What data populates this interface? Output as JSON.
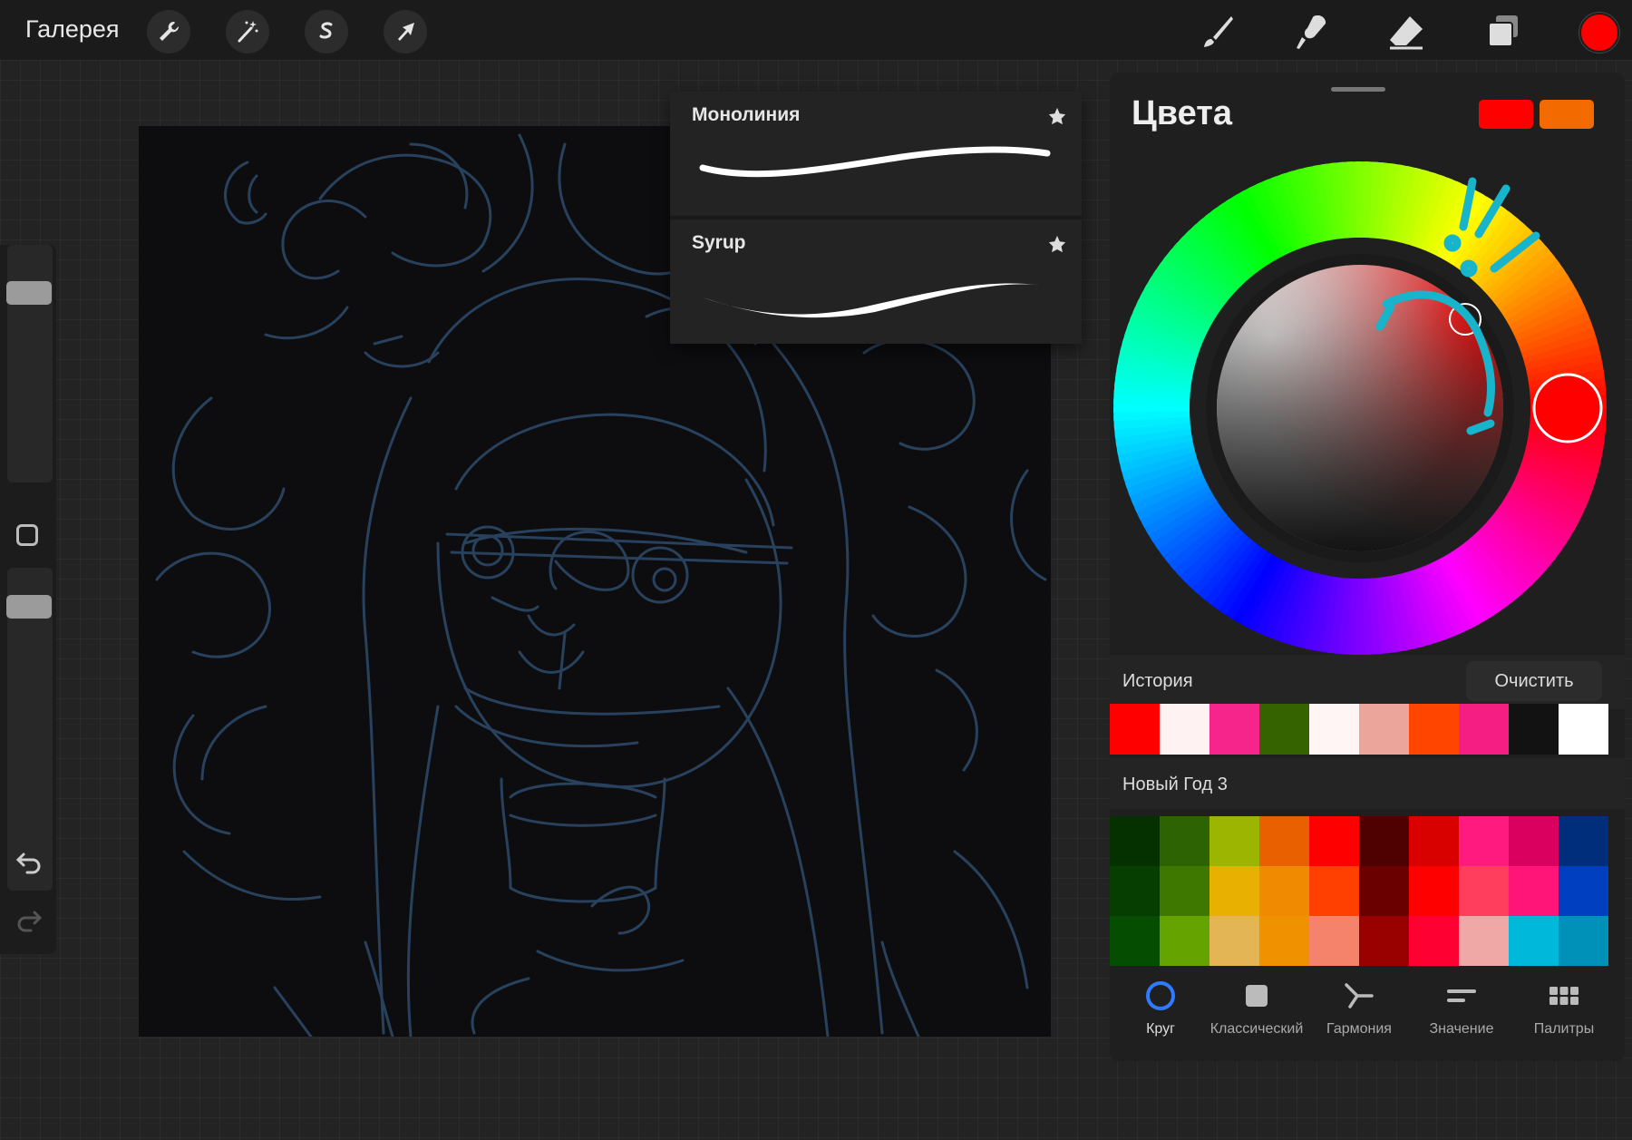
{
  "topbar": {
    "gallery_label": "Галерея",
    "current_color": "#ff0000"
  },
  "brushes": [
    {
      "name": "Монолиния",
      "favorite": true
    },
    {
      "name": "Syrup",
      "favorite": true
    }
  ],
  "colors_panel": {
    "title": "Цвета",
    "primary": "#ff0000",
    "secondary": "#f26a00",
    "history_label": "История",
    "clear_label": "Очистить",
    "history": [
      "#ff0000",
      "#fff2f2",
      "#f5258c",
      "#356300",
      "#fff5f5",
      "#eba59b",
      "#ff4500",
      "#f51e82",
      "#121212",
      "#ffffff"
    ],
    "palette_name": "Новый Год 3",
    "palette": [
      [
        "#053000",
        "#2e6303",
        "#9bb500",
        "#e86000",
        "#ff0000",
        "#4f0000",
        "#d90000",
        "#ff1a80",
        "#d90060",
        "#002e7a"
      ],
      [
        "#063d01",
        "#3f7800",
        "#e8b000",
        "#f08a00",
        "#ff4000",
        "#6b0000",
        "#ff0000",
        "#ff3d5c",
        "#ff1478",
        "#003fbf"
      ],
      [
        "#054d00",
        "#65a300",
        "#e3b555",
        "#f09200",
        "#f5826a",
        "#990000",
        "#ff0033",
        "#f0a8a6",
        "#00b8d9",
        "#0091b8"
      ]
    ],
    "tabs": [
      {
        "label": "Круг",
        "active": true
      },
      {
        "label": "Классический",
        "active": false
      },
      {
        "label": "Гармония",
        "active": false
      },
      {
        "label": "Значение",
        "active": false
      },
      {
        "label": "Палитры",
        "active": false
      }
    ]
  }
}
